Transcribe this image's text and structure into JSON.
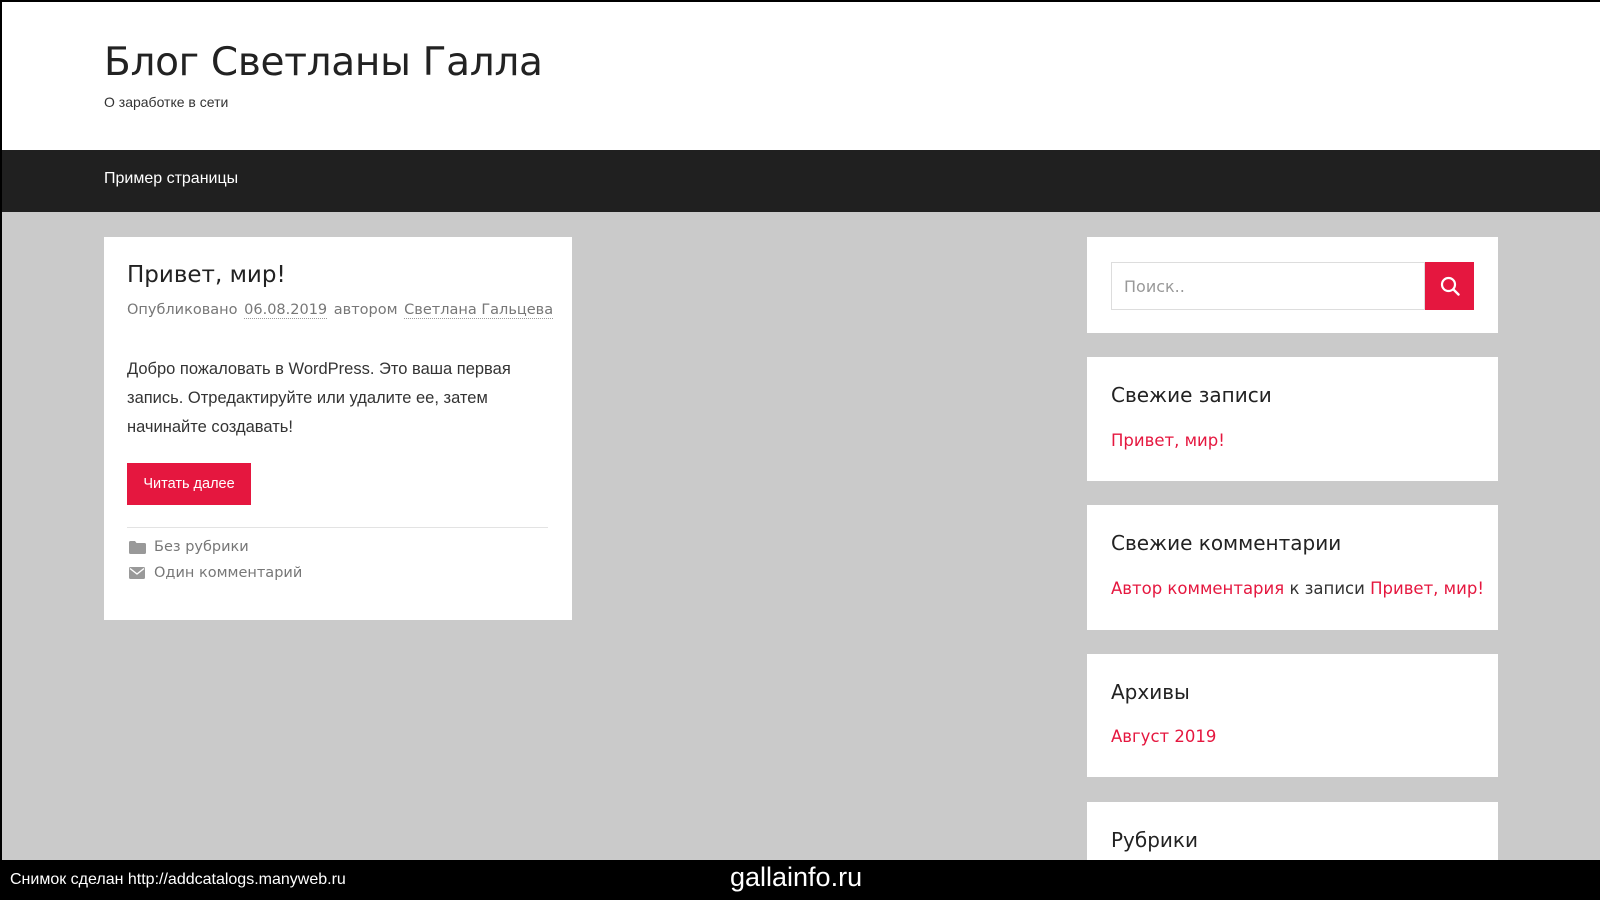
{
  "header": {
    "site_title": "Блог Светланы Галла",
    "site_description": "О заработке в сети"
  },
  "nav": {
    "items": [
      {
        "label": "Пример страницы"
      }
    ]
  },
  "post": {
    "title": "Привет, мир!",
    "meta": {
      "published_prefix": "Опубликовано",
      "date": "06.08.2019",
      "by": "автором",
      "author": "Светлана Гальцева"
    },
    "content": {
      "before_link": "Добро пожаловать в ",
      "link_text": "WordPress",
      "after_link": ". Это ваша первая запись. Отредактируйте или удалите ее, затем начинайте создавать!"
    },
    "read_more_label": "Читать далее",
    "category": {
      "icon": "folder-icon",
      "label": "Без рубрики"
    },
    "comments": {
      "icon": "envelope-icon",
      "label": "Один комментарий"
    }
  },
  "sidebar": {
    "search": {
      "placeholder": "Поиск..",
      "button_icon": "search-icon"
    },
    "recent_posts": {
      "title": "Свежие записи",
      "items": [
        "Привет, мир!"
      ]
    },
    "recent_comments": {
      "title": "Свежие комментарии",
      "author": "Автор комментария",
      "connector": "к записи",
      "post": "Привет, мир!"
    },
    "archives": {
      "title": "Архивы",
      "items": [
        "Август 2019"
      ]
    },
    "categories": {
      "title": "Рубрики"
    }
  },
  "footer_bar": {
    "credit": "Снимок сделан http://addcatalogs.manyweb.ru",
    "watermark": "gallainfo.ru"
  },
  "colors": {
    "accent": "#e5173f",
    "page_background": "#cacaca",
    "nav_background": "#202020"
  }
}
